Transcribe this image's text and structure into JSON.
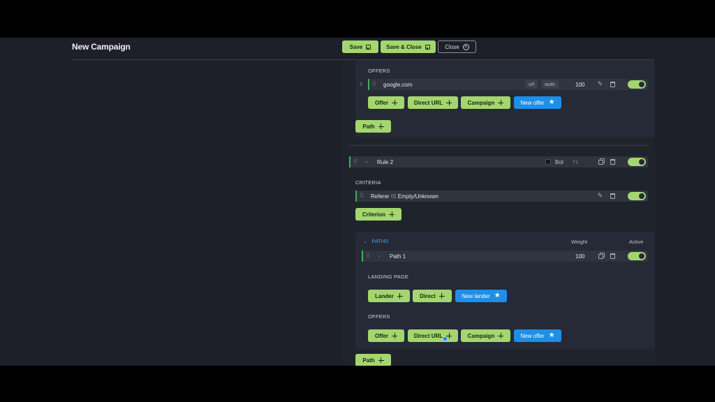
{
  "header": {
    "title": "New Campaign",
    "save_label": "Save",
    "save_close_label": "Save & Close",
    "close_label": "Close"
  },
  "upper_section": {
    "offers_label": "OFFERS",
    "offer_row": {
      "index": "1",
      "name": "google.com",
      "tag_url": "url",
      "tag_auto": "auto",
      "weight": "100"
    },
    "buttons": {
      "offer": "Offer",
      "direct_url": "Direct URL",
      "campaign": "Campaign",
      "new_offer": "New offer"
    },
    "path_button": "Path"
  },
  "rule2": {
    "name": "Rule 2",
    "bot_label": "Bot",
    "sort_arrows": "↑↓",
    "criteria_label": "CRITERIA",
    "criterion": {
      "field": "Referer",
      "operator": "IS",
      "value": "Empty/Unknown"
    },
    "criterion_button": "Criterion",
    "paths": {
      "label": "PATHS",
      "weight_header": "Weight",
      "active_header": "Active",
      "path_row": {
        "name": "Path 1",
        "weight": "100"
      },
      "landing_label": "LANDING PAGE",
      "landing_buttons": {
        "lander": "Lander",
        "direct": "Direct",
        "new_lander": "New lander"
      },
      "offers_label": "OFFERS",
      "offer_buttons": {
        "offer": "Offer",
        "direct_url": "Direct URL",
        "campaign": "Campaign",
        "new_offer": "New offer"
      }
    },
    "path_button": "Path"
  },
  "colors": {
    "accent_green": "#a4d66f",
    "accent_blue": "#1d8fe8",
    "status_green": "#3fae57",
    "background": "#1d2028"
  }
}
